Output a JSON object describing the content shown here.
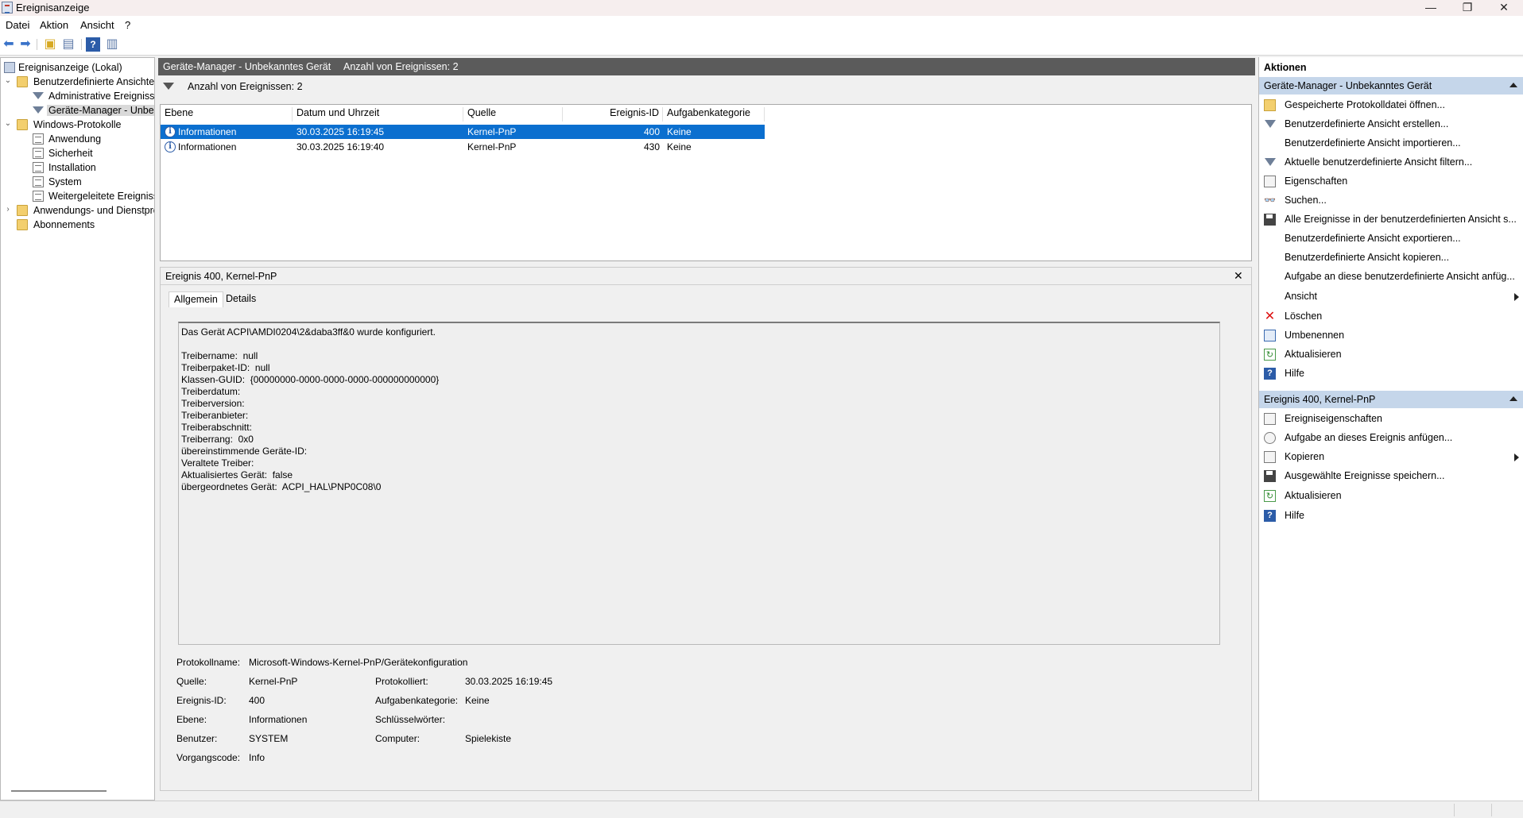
{
  "window": {
    "title": "Ereignisanzeige",
    "controls": [
      "—",
      "❐",
      "✕"
    ]
  },
  "menu": [
    "Datei",
    "Aktion",
    "Ansicht",
    "?"
  ],
  "tree": {
    "items": [
      {
        "label": "Ereignisanzeige (Lokal)"
      },
      {
        "label": "Benutzerdefinierte Ansichten"
      },
      {
        "label": "Administrative Ereignisse"
      },
      {
        "label": "Geräte-Manager - Unbekanntes Gerät"
      },
      {
        "label": "Windows-Protokolle"
      },
      {
        "label": "Anwendung"
      },
      {
        "label": "Sicherheit"
      },
      {
        "label": "Installation"
      },
      {
        "label": "System"
      },
      {
        "label": "Weitergeleitete Ereignisse"
      },
      {
        "label": "Anwendungs- und Dienstprotokolle"
      },
      {
        "label": "Abonnements"
      }
    ]
  },
  "center": {
    "title": "Geräte-Manager - Unbekanntes Gerät",
    "count_label": "Anzahl von Ereignissen: 2",
    "filter_label": "Anzahl von Ereignissen: 2",
    "columns": [
      "Ebene",
      "Datum und Uhrzeit",
      "Quelle",
      "Ereignis-ID",
      "Aufgabenkategorie"
    ],
    "rows": [
      {
        "level": "Informationen",
        "datetime": "30.03.2025 16:19:45",
        "source": "Kernel-PnP",
        "id": "400",
        "category": "Keine"
      },
      {
        "level": "Informationen",
        "datetime": "30.03.2025 16:19:40",
        "source": "Kernel-PnP",
        "id": "430",
        "category": "Keine"
      }
    ]
  },
  "detail": {
    "title": "Ereignis 400, Kernel-PnP",
    "tabs": [
      "Allgemein",
      "Details"
    ],
    "message": [
      "Das Gerät ACPI\\AMDI0204\\2&daba3ff&0 wurde konfiguriert.",
      "",
      "Treibername:  null",
      "Treiberpaket-ID:  null",
      "Klassen-GUID:  {00000000-0000-0000-0000-000000000000}",
      "Treiberdatum:",
      "Treiberversion:",
      "Treiberanbieter:",
      "Treiberabschnitt:",
      "Treiberrang:  0x0",
      "übereinstimmende Geräte-ID:",
      "Veraltete Treiber:",
      "Aktualisiertes Gerät:  false",
      "übergeordnetes Gerät:  ACPI_HAL\\PNP0C08\\0"
    ],
    "fields": {
      "protokollname_label": "Protokollname:",
      "protokollname": "Microsoft-Windows-Kernel-PnP/Gerätekonfiguration",
      "quelle_label": "Quelle:",
      "quelle": "Kernel-PnP",
      "protokolliert_label": "Protokolliert:",
      "protokolliert": "30.03.2025 16:19:45",
      "ereignisid_label": "Ereignis-ID:",
      "ereignisid": "400",
      "aufgabe_label": "Aufgabenkategorie:",
      "aufgabe": "Keine",
      "ebene_label": "Ebene:",
      "ebene": "Informationen",
      "schluessel_label": "Schlüsselwörter:",
      "schluessel": "",
      "benutzer_label": "Benutzer:",
      "benutzer": "SYSTEM",
      "computer_label": "Computer:",
      "computer": "Spielekiste",
      "vorgang_label": "Vorgangscode:",
      "vorgang": "Info"
    }
  },
  "actions": {
    "title": "Aktionen",
    "section1": "Geräte-Manager - Unbekanntes Gerät",
    "items1": [
      {
        "label": "Gespeicherte Protokolldatei öffnen...",
        "icon": "folder-open-icon"
      },
      {
        "label": "Benutzerdefinierte Ansicht erstellen...",
        "icon": "filter-new-icon"
      },
      {
        "label": "Benutzerdefinierte Ansicht importieren...",
        "icon": ""
      },
      {
        "label": "Aktuelle benutzerdefinierte Ansicht filtern...",
        "icon": "filter-icon"
      },
      {
        "label": "Eigenschaften",
        "icon": "properties-icon"
      },
      {
        "label": "Suchen...",
        "icon": "binoculars-icon"
      },
      {
        "label": "Alle Ereignisse in der benutzerdefinierten Ansicht s...",
        "icon": "save-icon"
      },
      {
        "label": "Benutzerdefinierte Ansicht exportieren...",
        "icon": ""
      },
      {
        "label": "Benutzerdefinierte Ansicht kopieren...",
        "icon": ""
      },
      {
        "label": "Aufgabe an diese benutzerdefinierte Ansicht anfüg...",
        "icon": ""
      },
      {
        "label": "Ansicht",
        "icon": ""
      },
      {
        "label": "Löschen",
        "icon": "delete-icon"
      },
      {
        "label": "Umbenennen",
        "icon": "rename-icon"
      },
      {
        "label": "Aktualisieren",
        "icon": "refresh-icon"
      },
      {
        "label": "Hilfe",
        "icon": "help-icon"
      }
    ],
    "section2": "Ereignis 400, Kernel-PnP",
    "items2": [
      {
        "label": "Ereigniseigenschaften",
        "icon": "event-properties-icon"
      },
      {
        "label": "Aufgabe an dieses Ereignis anfügen...",
        "icon": "task-icon"
      },
      {
        "label": "Kopieren",
        "icon": "copy-icon"
      },
      {
        "label": "Ausgewählte Ereignisse speichern...",
        "icon": "save-icon"
      },
      {
        "label": "Aktualisieren",
        "icon": "refresh-icon"
      },
      {
        "label": "Hilfe",
        "icon": "help-icon"
      }
    ]
  },
  "colors": {
    "selection": "#0b6fcf",
    "section_header": "#c5d6ea",
    "center_header": "#5b5b5b"
  }
}
